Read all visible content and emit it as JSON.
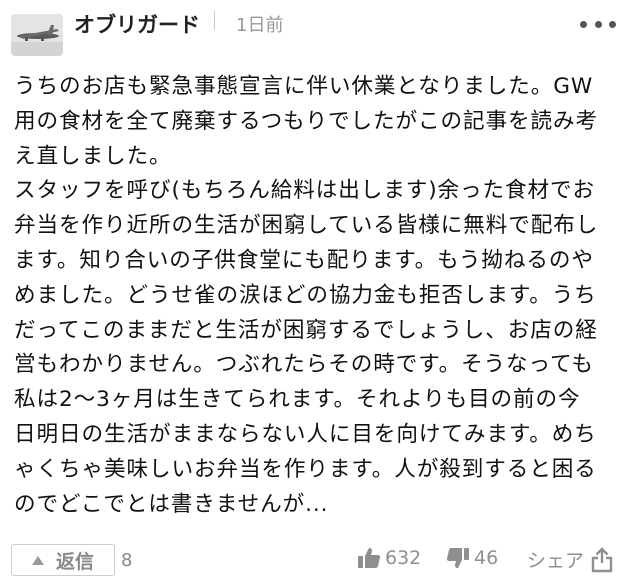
{
  "header": {
    "username": "オブリガード",
    "separator": "|",
    "time": "1日前",
    "avatar_icon": "airplane-avatar-icon",
    "more_icon": "more-dots-icon"
  },
  "comment": {
    "lines": [
      "うちのお店も緊急事態宣言に伴い休業となりました。GW",
      "用の食材を全て廃棄するつもりでしたがこの記事を読み考",
      "え直しました。",
      "スタッフを呼び(もちろん給料は出します)余った食材でお",
      "弁当を作り近所の生活が困窮している皆様に無料で配布し",
      "ます。知り合いの子供食堂にも配ります。もう拗ねるのや",
      "めました。どうせ雀の涙ほどの協力金も拒否します。うち",
      "だってこのままだと生活が困窮するでしょうし、お店の経",
      "営もわかりません。つぶれたらその時です。そうなっても",
      "私は2〜3ヶ月は生きてられます。それよりも目の前の今",
      "日明日の生活がままならない人に目を向けてみます。めち",
      "ゃくちゃ美味しいお弁当を作ります。人が殺到すると困る",
      "のでどこでとは書きませんが..."
    ]
  },
  "footer": {
    "reply_label": "返信",
    "reply_count": "8",
    "likes": "632",
    "dislikes": "46",
    "share_label": "シェア",
    "icons": {
      "reply": "triangle-up-icon",
      "like": "thumbs-up-icon",
      "dislike": "thumbs-down-icon",
      "share": "share-icon"
    }
  }
}
